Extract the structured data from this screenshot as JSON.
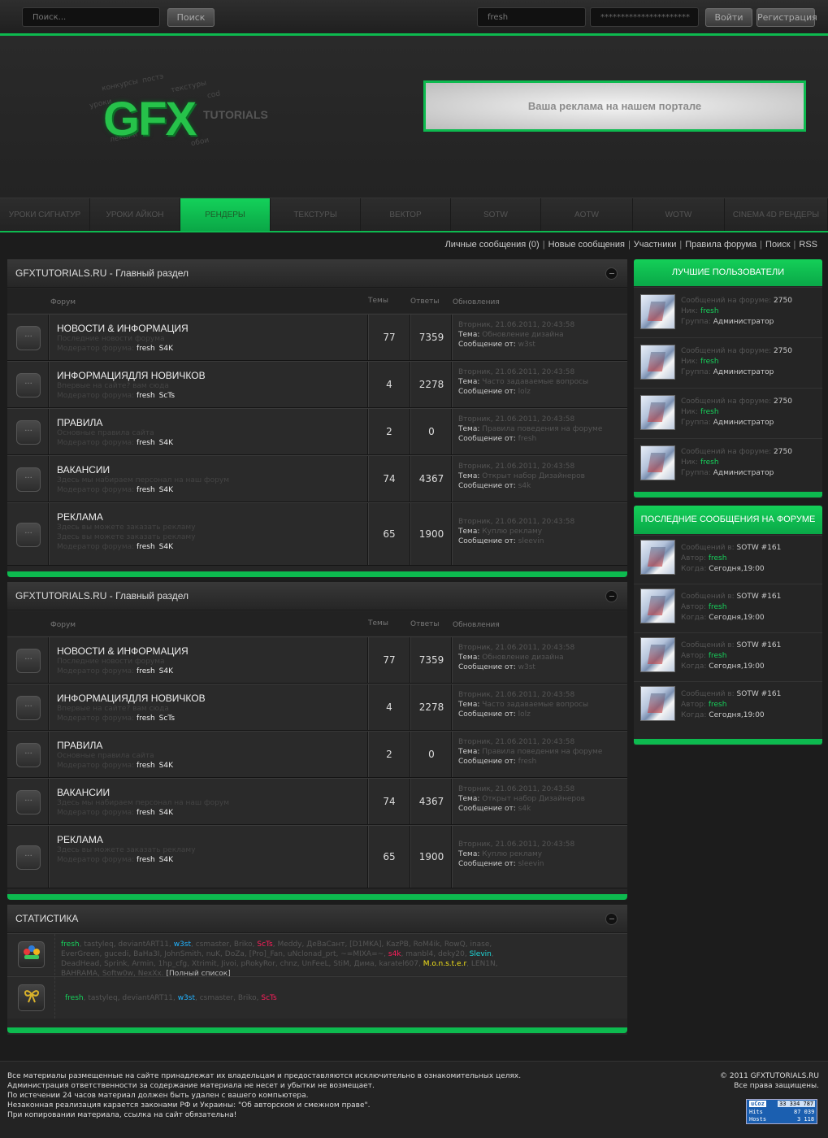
{
  "topbar": {
    "search_placeholder": "Поиск...",
    "search_button": "Поиск",
    "login_value": "fresh",
    "password_value": "**********************",
    "login_button": "Войти",
    "register_button": "Регистрация"
  },
  "header": {
    "logo_text": "GFX",
    "logo_sub": "TUTORIALS",
    "logo_words": [
      "конкурсы",
      "постэ",
      "текстуры",
      "уроки",
      "cod",
      "лекции",
      "обои"
    ],
    "ad_text": "Ваша реклама на нашем портале"
  },
  "nav": [
    "УРОКИ СИГНАТУР",
    "УРОКИ АЙКОН",
    "РЕНДЕРЫ",
    "ТЕКСТУРЫ",
    "ВЕКТОР",
    "SOTW",
    "AOTW",
    "WOTW",
    "CINEMA 4D РЕНДЕРЫ"
  ],
  "nav_active": "РЕНДЕРЫ",
  "toplinks": [
    "Личные сообщения (0)",
    "Новые сообщения",
    "Участники",
    "Правила форума",
    "Поиск",
    "RSS"
  ],
  "sections": [
    {
      "title": "GFXTUTORIALS.RU - Главный раздел",
      "col_forum": "Форум",
      "col_topics": "Темы",
      "col_posts": "Ответы",
      "col_updates": "Обновления",
      "forums": [
        {
          "name": "НОВОСТИ & ИНФОРМАЦИЯ",
          "desc": [
            "Последние новости форума"
          ],
          "mod_label": "Модератор форума:",
          "mods": [
            "fresh",
            "S4K"
          ],
          "topics": "77",
          "posts": "7359",
          "date": "Вторник, 21.06.2011, 20:43:58",
          "topic_label": "Тема:",
          "topic": "Обновление дизайна",
          "from_label": "Сообщение от:",
          "from": "w3st"
        },
        {
          "name": "ИНФОРМАЦИЯДЛЯ НОВИЧКОВ",
          "desc": [
            "Впервые на сайте? вам сюда"
          ],
          "mod_label": "Модератор форума:",
          "mods": [
            "fresh",
            "ScTs"
          ],
          "topics": "4",
          "posts": "2278",
          "date": "Вторник, 21.06.2011, 20:43:58",
          "topic_label": "Тема:",
          "topic": "Часто задаваемые вопросы",
          "from_label": "Сообщение от:",
          "from": "lolz"
        },
        {
          "name": "ПРАВИЛА",
          "desc": [
            "Основные правила сайта"
          ],
          "mod_label": "Модератор форума:",
          "mods": [
            "fresh",
            "S4K"
          ],
          "topics": "2",
          "posts": "0",
          "date": "Вторник, 21.06.2011, 20:43:58",
          "topic_label": "Тема:",
          "topic": "Правила поведения на форуме",
          "from_label": "Сообщение от:",
          "from": "fresh"
        },
        {
          "name": "ВАКАНСИИ",
          "desc": [
            "Здесь мы набираем персонал на наш форум"
          ],
          "mod_label": "Модератор форума:",
          "mods": [
            "fresh",
            "S4K"
          ],
          "topics": "74",
          "posts": "4367",
          "date": "Вторник, 21.06.2011, 20:43:58",
          "topic_label": "Тема:",
          "topic": "Открыт набор Дизайнеров",
          "from_label": "Сообщение от:",
          "from": "s4k"
        },
        {
          "name": "РЕКЛАМА",
          "desc": [
            "Здесь вы можете заказать рекламу",
            "Здесь вы можете заказать рекламу"
          ],
          "mod_label": "Модератор форума:",
          "mods": [
            "fresh",
            "S4K"
          ],
          "topics": "65",
          "posts": "1900",
          "date": "Вторник, 21.06.2011, 20:43:58",
          "topic_label": "Тема:",
          "topic": "Куплю рекламу",
          "from_label": "Сообщение от:",
          "from": "sleevin"
        }
      ]
    },
    {
      "title": "GFXTUTORIALS.RU - Главный раздел",
      "col_forum": "Форум",
      "col_topics": "Темы",
      "col_posts": "Ответы",
      "col_updates": "Обновления",
      "forums": [
        {
          "name": "НОВОСТИ & ИНФОРМАЦИЯ",
          "desc": [
            "Последние новости форума"
          ],
          "mod_label": "Модератор форума:",
          "mods": [
            "fresh",
            "S4K"
          ],
          "topics": "77",
          "posts": "7359",
          "date": "Вторник, 21.06.2011, 20:43:58",
          "topic_label": "Тема:",
          "topic": "Обновление дизайна",
          "from_label": "Сообщение от:",
          "from": "w3st"
        },
        {
          "name": "ИНФОРМАЦИЯДЛЯ НОВИЧКОВ",
          "desc": [
            "Впервые на сайте? вам сюда"
          ],
          "mod_label": "Модератор форума:",
          "mods": [
            "fresh",
            "ScTs"
          ],
          "topics": "4",
          "posts": "2278",
          "date": "Вторник, 21.06.2011, 20:43:58",
          "topic_label": "Тема:",
          "topic": "Часто задаваемые вопросы",
          "from_label": "Сообщение от:",
          "from": "lolz"
        },
        {
          "name": "ПРАВИЛА",
          "desc": [
            "Основные правила сайта"
          ],
          "mod_label": "Модератор форума:",
          "mods": [
            "fresh",
            "S4K"
          ],
          "topics": "2",
          "posts": "0",
          "date": "Вторник, 21.06.2011, 20:43:58",
          "topic_label": "Тема:",
          "topic": "Правила поведения на форуме",
          "from_label": "Сообщение от:",
          "from": "fresh"
        },
        {
          "name": "ВАКАНСИИ",
          "desc": [
            "Здесь мы набираем персонал на наш форум"
          ],
          "mod_label": "Модератор форума:",
          "mods": [
            "fresh",
            "S4K"
          ],
          "topics": "74",
          "posts": "4367",
          "date": "Вторник, 21.06.2011, 20:43:58",
          "topic_label": "Тема:",
          "topic": "Открыт набор Дизайнеров",
          "from_label": "Сообщение от:",
          "from": "s4k"
        },
        {
          "name": "РЕКЛАМА",
          "desc": [
            "Здесь вы можете заказать рекламу"
          ],
          "mod_label": "Модератор форума:",
          "mods": [
            "fresh",
            "S4K"
          ],
          "topics": "65",
          "posts": "1900",
          "date": "Вторник, 21.06.2011, 20:43:58",
          "topic_label": "Тема:",
          "topic": "Куплю рекламу",
          "from_label": "Сообщение от:",
          "from": "sleevin"
        }
      ]
    }
  ],
  "stats": {
    "title": "СТАТИСТИКА",
    "online_users": [
      {
        "n": "fresh",
        "c": "g"
      },
      {
        "n": "tastyleq",
        "c": ""
      },
      {
        "n": "deviantART11",
        "c": ""
      },
      {
        "n": "w3st",
        "c": "b"
      },
      {
        "n": "csmaster",
        "c": ""
      },
      {
        "n": "Briko",
        "c": ""
      },
      {
        "n": "ScTs",
        "c": "r"
      },
      {
        "n": "Meddy",
        "c": ""
      },
      {
        "n": "ДеВаСант",
        "c": ""
      },
      {
        "n": "[D1MKA]",
        "c": ""
      },
      {
        "n": "KazPB",
        "c": ""
      },
      {
        "n": "RoM4ik",
        "c": ""
      },
      {
        "n": "RowQ",
        "c": ""
      },
      {
        "n": "inase",
        "c": ""
      },
      {
        "n": "EverGreen",
        "c": ""
      },
      {
        "n": "gucedi",
        "c": ""
      },
      {
        "n": "BaHa3I",
        "c": ""
      },
      {
        "n": "JohnSmith",
        "c": ""
      },
      {
        "n": "nuK",
        "c": ""
      },
      {
        "n": "DoZa",
        "c": ""
      },
      {
        "n": "[Pro]_Fan",
        "c": ""
      },
      {
        "n": "uNclonad_prt",
        "c": ""
      },
      {
        "n": "~=MIXA=~",
        "c": ""
      },
      {
        "n": "s4k",
        "c": "r"
      },
      {
        "n": "manbl4",
        "c": ""
      },
      {
        "n": "deky20",
        "c": ""
      },
      {
        "n": "Slevin",
        "c": "c"
      },
      {
        "n": "DeadHead",
        "c": ""
      },
      {
        "n": "Sprink",
        "c": ""
      },
      {
        "n": "Armin",
        "c": ""
      },
      {
        "n": "1hp_cfg",
        "c": ""
      },
      {
        "n": "Xtrimit",
        "c": ""
      },
      {
        "n": "Jivoi",
        "c": ""
      },
      {
        "n": "pRokyRor",
        "c": ""
      },
      {
        "n": "chnz",
        "c": ""
      },
      {
        "n": "UnFeeL",
        "c": ""
      },
      {
        "n": "StiM",
        "c": ""
      },
      {
        "n": "Дима",
        "c": ""
      },
      {
        "n": "karatel607",
        "c": ""
      },
      {
        "n": "M.o.n.s.t.e.r",
        "c": "y"
      },
      {
        "n": "LEN1N",
        "c": ""
      },
      {
        "n": "BAHRAMA",
        "c": ""
      },
      {
        "n": "Softw0w",
        "c": ""
      },
      {
        "n": "NexXx",
        "c": ""
      }
    ],
    "full_list": "[Полный список]",
    "birthday_users": [
      {
        "n": "fresh",
        "c": "g"
      },
      {
        "n": "tastyleq",
        "c": ""
      },
      {
        "n": "deviantART11",
        "c": ""
      },
      {
        "n": "w3st",
        "c": "b"
      },
      {
        "n": "csmaster",
        "c": ""
      },
      {
        "n": "Briko",
        "c": ""
      },
      {
        "n": "ScTs",
        "c": "r"
      }
    ]
  },
  "best_users": {
    "title": "ЛУЧШИЕ ПОЛЬЗОВАТЕЛИ",
    "items": [
      {
        "posts_label": "Сообщений на форуме:",
        "posts": "2750",
        "nick_label": "Ник:",
        "nick": "fresh",
        "group_label": "Группа:",
        "group": "Администратор"
      },
      {
        "posts_label": "Сообщений на форуме:",
        "posts": "2750",
        "nick_label": "Ник:",
        "nick": "fresh",
        "group_label": "Группа:",
        "group": "Администратор"
      },
      {
        "posts_label": "Сообщений на форуме:",
        "posts": "2750",
        "nick_label": "Ник:",
        "nick": "fresh",
        "group_label": "Группа:",
        "group": "Администратор"
      },
      {
        "posts_label": "Сообщений на форуме:",
        "posts": "2750",
        "nick_label": "Ник:",
        "nick": "fresh",
        "group_label": "Группа:",
        "group": "Администратор"
      }
    ]
  },
  "last_posts": {
    "title": "ПОСЛЕДНИЕ СООБЩЕНИЯ НА ФОРУМЕ",
    "items": [
      {
        "in_label": "Сообщений в:",
        "in": "SOTW #161",
        "author_label": "Автор:",
        "author": "fresh",
        "when_label": "Когда:",
        "when": "Сегодня,19:00"
      },
      {
        "in_label": "Сообщений в:",
        "in": "SOTW #161",
        "author_label": "Автор:",
        "author": "fresh",
        "when_label": "Когда:",
        "when": "Сегодня,19:00"
      },
      {
        "in_label": "Сообщений в:",
        "in": "SOTW #161",
        "author_label": "Автор:",
        "author": "fresh",
        "when_label": "Когда:",
        "when": "Сегодня,19:00"
      },
      {
        "in_label": "Сообщений в:",
        "in": "SOTW #161",
        "author_label": "Автор:",
        "author": "fresh",
        "when_label": "Когда:",
        "when": "Сегодня,19:00"
      }
    ]
  },
  "footer": {
    "lines": [
      "Все материалы размещенные на сайте принадлежат их владельцам и предоставляются исключительно в ознакомительных целях.",
      "Администрация ответственности за содержание материала не несет и убытки не возмещает.",
      "По истечении 24 часов материал должен быть удален с вашего компьютера.",
      "Незаконная реализация карается законами РФ и Украины: \"Об авторском и смежном праве\".",
      "При копировании материала, ссылка на сайт обязательна!"
    ],
    "copyright": "© 2011 GFXTUTORIALS.RU",
    "rights": "Все права защищены.",
    "counter_brand": "uCoz",
    "counter_total": "33 334 787",
    "counter_hits_label": "Hits",
    "counter_hits": "87 039",
    "counter_hosts_label": "Hosts",
    "counter_hosts": "3 118"
  },
  "colors": {
    "accent": "#0dba4f",
    "nick_green": "#17d05b",
    "blue": "#21b3ff",
    "red": "#ff1e5c",
    "yellow": "#f3e21a",
    "cyan": "#1fd5d5"
  }
}
